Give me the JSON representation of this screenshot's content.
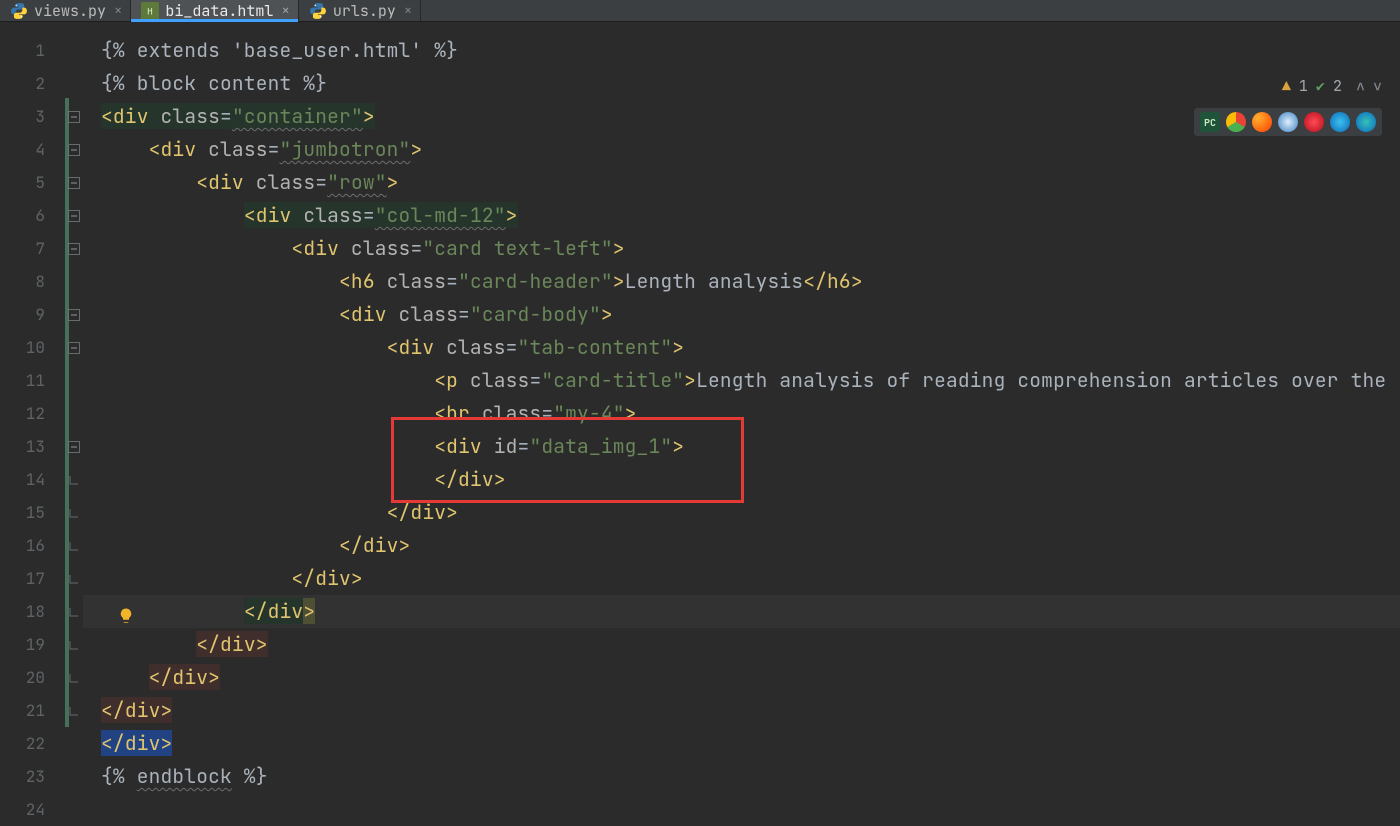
{
  "tabs": [
    {
      "label": "views.py",
      "icon": "python"
    },
    {
      "label": "bi_data.html",
      "icon": "html",
      "active": true
    },
    {
      "label": "urls.py",
      "icon": "python"
    }
  ],
  "line_count": 24,
  "caret_line": 18,
  "bulb_line": 18,
  "change_bar": {
    "start": 3,
    "end": 21
  },
  "annotation_box": {
    "start_line": 12.8,
    "end_line": 14.5,
    "left_ch": 28,
    "right_ch": 62
  },
  "inspections": {
    "warnings": 1,
    "passes": 2
  },
  "code_lines": [
    {
      "n": 1,
      "indent": 0,
      "tokens": [
        {
          "t": "txt",
          "v": "{% extends 'base_user.html' %}"
        }
      ]
    },
    {
      "n": 2,
      "indent": 0,
      "tokens": [
        {
          "t": "txt",
          "v": "{% block content %}"
        }
      ]
    },
    {
      "n": 3,
      "indent": 0,
      "fold": "minus",
      "tokens": [
        {
          "t": "open",
          "highlight": true,
          "tag": "div",
          "attrs": [
            [
              "class",
              "container",
              true
            ]
          ]
        }
      ]
    },
    {
      "n": 4,
      "indent": 1,
      "fold": "minus",
      "tokens": [
        {
          "t": "open",
          "tag": "div",
          "attrs": [
            [
              "class",
              "jumbotron",
              true
            ]
          ]
        }
      ]
    },
    {
      "n": 5,
      "indent": 2,
      "fold": "minus",
      "tokens": [
        {
          "t": "open",
          "tag": "div",
          "attrs": [
            [
              "class",
              "row",
              true
            ]
          ]
        }
      ]
    },
    {
      "n": 6,
      "indent": 3,
      "fold": "minus",
      "tokens": [
        {
          "t": "open",
          "highlight": true,
          "tag": "div",
          "attrs": [
            [
              "class",
              "col-md-12",
              true
            ]
          ]
        }
      ]
    },
    {
      "n": 7,
      "indent": 4,
      "fold": "minus",
      "tokens": [
        {
          "t": "open",
          "tag": "div",
          "attrs": [
            [
              "class",
              "card text-left",
              false
            ]
          ]
        }
      ]
    },
    {
      "n": 8,
      "indent": 5,
      "tokens": [
        {
          "t": "open",
          "tag": "h6",
          "attrs": [
            [
              "class",
              "card-header",
              false
            ]
          ]
        },
        {
          "t": "txt",
          "v": "Length analysis"
        },
        {
          "t": "close",
          "tag": "h6"
        }
      ]
    },
    {
      "n": 9,
      "indent": 5,
      "fold": "minus",
      "tokens": [
        {
          "t": "open",
          "tag": "div",
          "attrs": [
            [
              "class",
              "card-body",
              false
            ]
          ]
        }
      ]
    },
    {
      "n": 10,
      "indent": 6,
      "fold": "minus",
      "tokens": [
        {
          "t": "open",
          "tag": "div",
          "attrs": [
            [
              "class",
              "tab-content",
              false
            ]
          ]
        }
      ]
    },
    {
      "n": 11,
      "indent": 7,
      "tokens": [
        {
          "t": "open",
          "tag": "p",
          "attrs": [
            [
              "class",
              "card-title",
              false
            ]
          ]
        },
        {
          "t": "txt",
          "v": "Length analysis of reading comprehension articles over the"
        }
      ]
    },
    {
      "n": 12,
      "indent": 7,
      "tokens": [
        {
          "t": "open",
          "tag": "hr",
          "attrs": [
            [
              "class",
              "my-4",
              false
            ]
          ]
        }
      ]
    },
    {
      "n": 13,
      "indent": 7,
      "fold": "minus",
      "tokens": [
        {
          "t": "open",
          "tag": "div",
          "attrs": [
            [
              "id",
              "data_img_1",
              false
            ]
          ]
        }
      ]
    },
    {
      "n": 14,
      "indent": 7,
      "fold": "up",
      "tokens": [
        {
          "t": "close",
          "tag": "div"
        }
      ]
    },
    {
      "n": 15,
      "indent": 6,
      "fold": "up",
      "tokens": [
        {
          "t": "close",
          "tag": "div"
        }
      ]
    },
    {
      "n": 16,
      "indent": 5,
      "fold": "up",
      "tokens": [
        {
          "t": "close",
          "tag": "div"
        }
      ]
    },
    {
      "n": 17,
      "indent": 4,
      "fold": "up",
      "tokens": [
        {
          "t": "close",
          "tag": "div"
        }
      ]
    },
    {
      "n": 18,
      "indent": 3,
      "fold": "up",
      "caret": true,
      "tokens": [
        {
          "t": "close",
          "tag": "div",
          "highlight": true,
          "caret_after": true
        }
      ]
    },
    {
      "n": 19,
      "indent": 2,
      "fold": "up",
      "tokens": [
        {
          "t": "close",
          "tag": "div",
          "closehighlight": true
        }
      ]
    },
    {
      "n": 20,
      "indent": 1,
      "fold": "up",
      "tokens": [
        {
          "t": "close",
          "tag": "div",
          "closehighlight": true
        }
      ]
    },
    {
      "n": 21,
      "indent": 0,
      "fold": "up",
      "tokens": [
        {
          "t": "close",
          "tag": "div",
          "closehighlight": true
        }
      ]
    },
    {
      "n": 22,
      "indent": 0,
      "tokens": [
        {
          "t": "close",
          "tag": "div",
          "sel": true
        }
      ]
    },
    {
      "n": 23,
      "indent": 0,
      "tokens": [
        {
          "t": "txt",
          "v": "{% "
        },
        {
          "t": "txt",
          "u": true,
          "v": "endblock"
        },
        {
          "t": "txt",
          "v": " %}"
        }
      ]
    },
    {
      "n": 24,
      "indent": 0,
      "tokens": []
    }
  ]
}
